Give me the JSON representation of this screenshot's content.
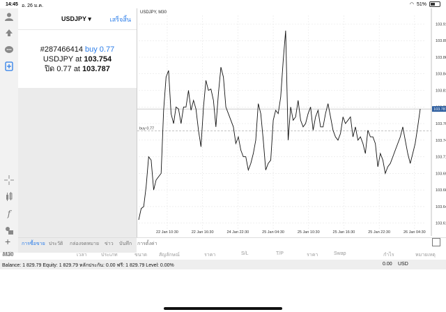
{
  "status_bar": {
    "time": "14:45",
    "date": "อ. 26 ม.ค.",
    "battery": "51%"
  },
  "left_toolbar": {
    "timeframe_label": "M30"
  },
  "trade_panel": {
    "symbol": "USDJPY ▾",
    "done_label": "เสร็จสิ้น",
    "order_line1_prefix": "#287466414",
    "order_line1_action": "buy 0.77",
    "order_line2_prefix": "USDJPY at",
    "order_line2_value": "103.754",
    "order_line3_prefix": "ปิด 0.77 at",
    "order_line3_value": "103.787"
  },
  "chart": {
    "title": "USDJPY, M30",
    "current_price_label": "103.787",
    "order_line_label": "buy 0.77",
    "accent": "#2b5c9e"
  },
  "chart_data": {
    "type": "line",
    "title": "USDJPY, M30",
    "x_tick_labels": [
      "22 Jan 10:30",
      "22 Jan 16:30",
      "24 Jan 22:30",
      "25 Jan 04:30",
      "25 Jan 10:30",
      "25 Jan 16:30",
      "25 Jan 22:30",
      "26 Jan 04:30"
    ],
    "y_tick_labels": [
      "103.915",
      "103.890",
      "103.865",
      "103.840",
      "103.815",
      "103.790",
      "103.765",
      "103.740",
      "103.715",
      "103.690",
      "103.665",
      "103.640",
      "103.615"
    ],
    "ylim": [
      103.6,
      103.928
    ],
    "current_price": 103.787,
    "order_price": 103.754,
    "values": [
      103.62,
      103.637,
      103.64,
      103.67,
      103.715,
      103.71,
      103.665,
      103.68,
      103.685,
      103.69,
      103.785,
      103.835,
      103.845,
      103.78,
      103.765,
      103.79,
      103.787,
      103.765,
      103.79,
      103.79,
      103.815,
      103.785,
      103.8,
      103.787,
      103.755,
      103.73,
      103.79,
      103.83,
      103.815,
      103.817,
      103.8,
      103.76,
      103.81,
      103.85,
      103.835,
      103.79,
      103.78,
      103.77,
      103.76,
      103.735,
      103.745,
      103.725,
      103.715,
      103.715,
      103.695,
      103.705,
      103.72,
      103.74,
      103.795,
      103.78,
      103.74,
      103.695,
      103.705,
      103.71,
      103.77,
      103.785,
      103.78,
      103.805,
      103.86,
      103.905,
      103.74,
      103.79,
      103.77,
      103.775,
      103.8,
      103.77,
      103.76,
      103.765,
      103.78,
      103.79,
      103.755,
      103.775,
      103.785,
      103.76,
      103.76,
      103.78,
      103.795,
      103.775,
      103.755,
      103.745,
      103.74,
      103.75,
      103.775,
      103.765,
      103.77,
      103.775,
      103.745,
      103.76,
      103.74,
      103.745,
      103.735,
      103.72,
      103.755,
      103.745,
      103.745,
      103.735,
      103.7,
      103.72,
      103.71,
      103.69,
      103.7,
      103.705,
      103.715,
      103.725,
      103.735,
      103.745,
      103.76,
      103.74,
      103.72,
      103.705,
      103.72,
      103.735,
      103.76,
      103.787
    ]
  },
  "tabs": [
    "การซื้อขาย",
    "ประวัติ",
    "กล่องจดหมาย",
    "ข่าว",
    "บันทึก",
    "การตั้งค่า"
  ],
  "columns": [
    "คำสั่ง",
    "เวลา",
    "ประเภท",
    "ขนาด",
    "สัญลักษณ์",
    "ราคา",
    "S/L",
    "T/P",
    "ราคา",
    "Swap",
    "กำไร",
    "หมายเหตุ"
  ],
  "balance": {
    "text": "Balance: 1 829.79 Equity: 1 829.79 หลักประกัน: 0.00 ฟรี: 1 829.79 Level: 0.00%",
    "profit": "0.00",
    "currency": "USD"
  }
}
